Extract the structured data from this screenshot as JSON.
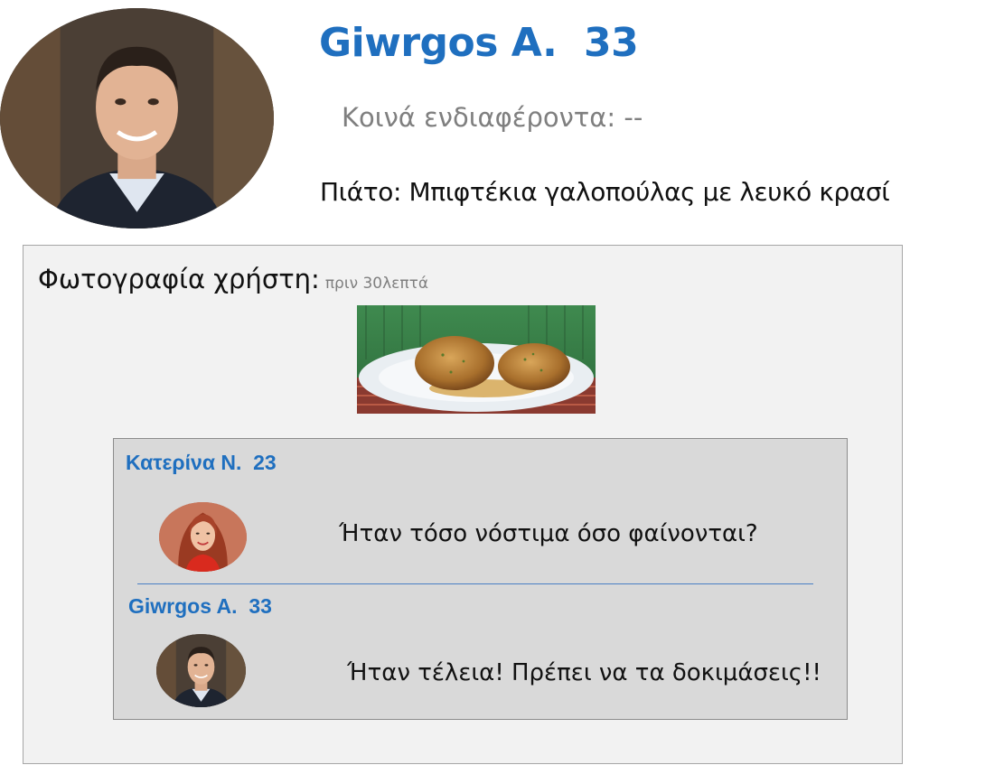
{
  "profile": {
    "name": "Giwrgos A.  33",
    "shared_interests": "Κοινά ενδιαφέροντα: --",
    "dish": "Πιάτο: Μπιφτέκια γαλοπούλας με λευκό κρασί"
  },
  "post": {
    "heading": "Φωτογραφία χρήστη:",
    "time_ago": "πριν 30λεπτά"
  },
  "comments": [
    {
      "author": "Κατερίνα Ν.  23",
      "text": "Ήταν τόσο νόστιμα όσο φαίνονται?"
    },
    {
      "author": "Giwrgos A.  33",
      "text": "Ήταν τέλεια! Πρέπει να τα δοκιμάσεις!!"
    }
  ],
  "colors": {
    "accent": "#1f6fbf",
    "muted_text": "#7f7f7f",
    "panel_bg": "#f2f2f2",
    "comments_bg": "#d9d9d9",
    "divider": "#4a7fc4"
  }
}
